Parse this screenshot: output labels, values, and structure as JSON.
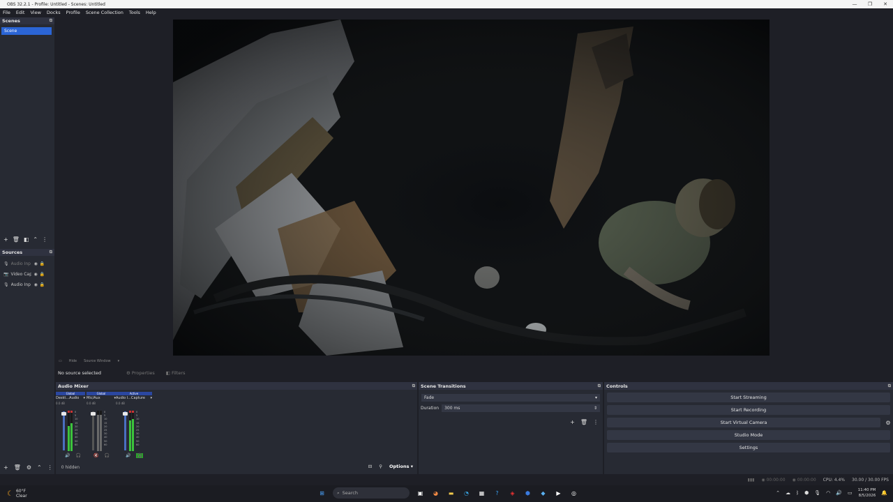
{
  "window": {
    "title": "OBS 32.2.1 - Profile: Untitled - Scenes: Untitled",
    "minimize": "—",
    "maximize": "❐",
    "close": "✕"
  },
  "menu": [
    "File",
    "Edit",
    "View",
    "Docks",
    "Profile",
    "Scene Collection",
    "Tools",
    "Help"
  ],
  "scenes": {
    "title": "Scenes",
    "items": [
      "Scene"
    ]
  },
  "sources": {
    "title": "Sources",
    "items": [
      {
        "label": "Audio Inp",
        "dim": true
      },
      {
        "label": "Video Cap",
        "dim": false
      },
      {
        "label": "Audio Inp",
        "dim": false
      }
    ]
  },
  "source_toolbar": {
    "text1": "Hide",
    "text2": "Source Window"
  },
  "props_bar": {
    "no_source": "No source selected",
    "properties": "Properties",
    "filters": "Filters"
  },
  "audio_mixer": {
    "title": "Audio Mixer",
    "channels": [
      {
        "badge": "Global",
        "name": "Deskt...Audio",
        "db": "0.0 dB"
      },
      {
        "badge": "Global",
        "name": "Mic/Aux",
        "db": "0.0 dB"
      },
      {
        "badge": "Active",
        "name": "Audio I...Capture",
        "db": "0.0 dB"
      }
    ],
    "options": "Options",
    "hidden": "0 hidden"
  },
  "scene_transitions": {
    "title": "Scene Transitions",
    "transition": "Fade",
    "duration_label": "Duration",
    "duration": "300 ms"
  },
  "controls": {
    "title": "Controls",
    "start_streaming": "Start Streaming",
    "start_recording": "Start Recording",
    "start_virtual_camera": "Start Virtual Camera",
    "studio_mode": "Studio Mode",
    "settings": "Settings"
  },
  "status": {
    "stream_time": "00:00:00",
    "rec_time": "00:00:00",
    "cpu": "CPU: 4.4%",
    "fps": "30.00 / 30.00 FPS"
  },
  "taskbar": {
    "temp": "60°F",
    "condition": "Clear",
    "search_placeholder": "Search",
    "time": "11:40 PM",
    "date": "8/5/2026"
  }
}
